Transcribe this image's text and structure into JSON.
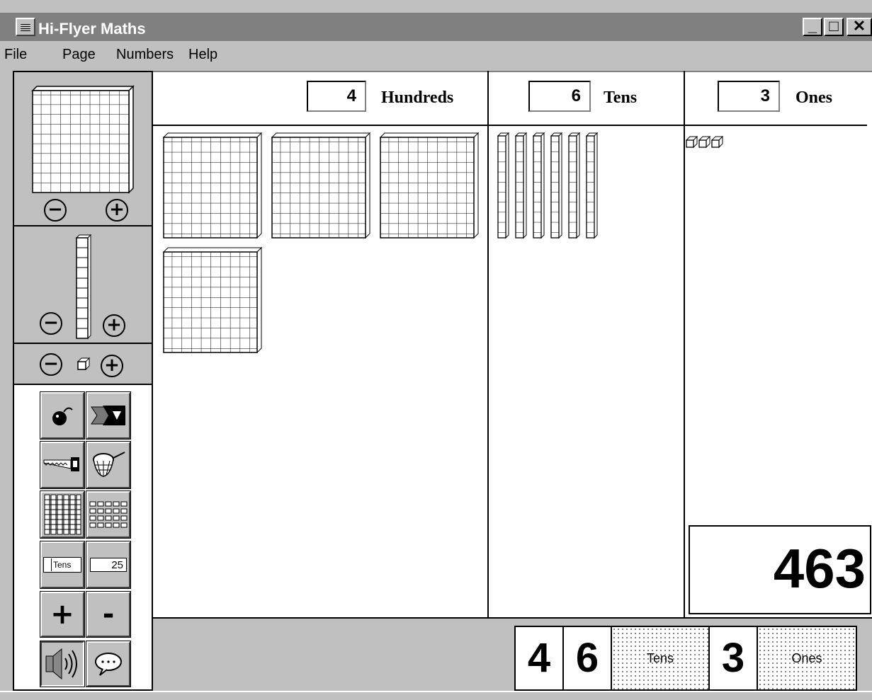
{
  "window": {
    "title": "Hi-Flyer Maths",
    "min": "_",
    "max": "□",
    "close": "✕"
  },
  "menu": [
    "File",
    "Page",
    "Numbers",
    "Help"
  ],
  "left_controls": {
    "minus": "−",
    "plus": "+"
  },
  "tools": {
    "tens_label": "Tens",
    "number_field": "25",
    "add": "+",
    "subtract": "-"
  },
  "columns": {
    "hundreds": {
      "count": "4",
      "label": "Hundreds"
    },
    "tens": {
      "count": "6",
      "label": "Tens"
    },
    "ones": {
      "count": "3",
      "label": "Ones"
    }
  },
  "total": "463",
  "digit_strip": {
    "hundreds_digit": "4",
    "tens_digit": "6",
    "tens_label": "Tens",
    "ones_digit": "3",
    "ones_label": "Ones"
  }
}
